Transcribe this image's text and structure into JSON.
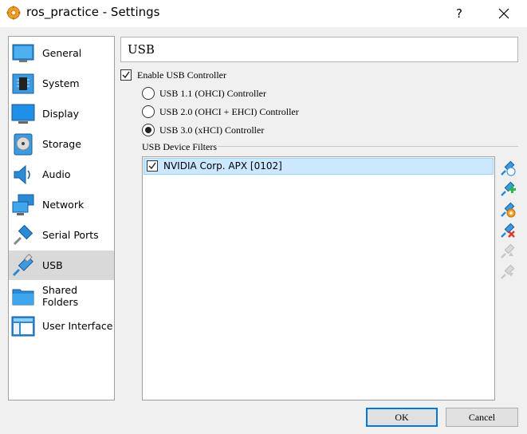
{
  "window": {
    "title": "ros_practice - Settings",
    "help_label": "?",
    "app_icon": "virtualbox-settings-icon",
    "close_icon": "close-icon"
  },
  "sidebar": {
    "items": [
      {
        "label": "General",
        "icon": "general-icon"
      },
      {
        "label": "System",
        "icon": "system-chip-icon"
      },
      {
        "label": "Display",
        "icon": "display-monitor-icon"
      },
      {
        "label": "Storage",
        "icon": "storage-disk-icon"
      },
      {
        "label": "Audio",
        "icon": "audio-speaker-icon"
      },
      {
        "label": "Network",
        "icon": "network-icon"
      },
      {
        "label": "Serial Ports",
        "icon": "serial-port-icon"
      },
      {
        "label": "USB",
        "icon": "usb-icon"
      },
      {
        "label": "Shared Folders",
        "icon": "shared-folder-icon"
      },
      {
        "label": "User Interface",
        "icon": "user-interface-icon"
      }
    ],
    "selected": "USB",
    "selected_color": "#d9d9d9"
  },
  "page": {
    "title": "USB",
    "enable_usb_label": "Enable USB Controller",
    "enable_usb_checked": true,
    "controllers": [
      {
        "label": "USB 1.1 (OHCI) Controller",
        "selected": false
      },
      {
        "label": "USB 2.0 (OHCI + EHCI) Controller",
        "selected": false
      },
      {
        "label": "USB 3.0 (xHCI) Controller",
        "selected": true
      }
    ],
    "filters_label": "USB Device Filters",
    "filters": [
      {
        "label": "NVIDIA Corp. APX [0102]",
        "checked": true
      }
    ],
    "filter_selection_color": "#cce8ff",
    "tools": [
      {
        "icon": "add-empty-filter-icon",
        "enabled": true
      },
      {
        "icon": "add-filter-from-device-icon",
        "enabled": true
      },
      {
        "icon": "edit-filter-icon",
        "enabled": true
      },
      {
        "icon": "remove-filter-icon",
        "enabled": true
      },
      {
        "icon": "move-filter-up-icon",
        "enabled": false
      },
      {
        "icon": "move-filter-down-icon",
        "enabled": false
      }
    ]
  },
  "buttons": {
    "ok": "OK",
    "cancel": "Cancel",
    "ok_border_color": "#0078d7"
  }
}
